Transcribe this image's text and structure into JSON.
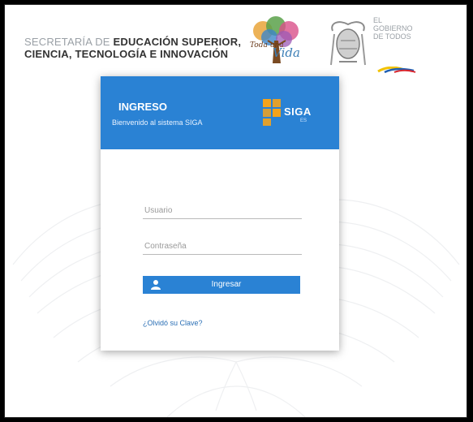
{
  "header": {
    "ministry_line1_light": "SECRETARÍA DE",
    "ministry_line1_bold": "EDUCACIÓN SUPERIOR,",
    "ministry_line2": "CIENCIA, TECNOLOGÍA E INNOVACIÓN",
    "tree_logo_text": "Toda una",
    "tree_logo_vida": "Vida",
    "gov_el": "EL",
    "gov_line": "GOBIERNO",
    "gov_line2": "DE TODOS"
  },
  "login": {
    "title": "INGRESO",
    "subtitle": "Bienvenido al sistema SIGA",
    "brand": "SIGA",
    "brand_sub": "ES",
    "username_placeholder": "Usuario",
    "password_placeholder": "Contraseña",
    "submit_label": "Ingresar",
    "forgot_label": "¿Olvidó su Clave?"
  },
  "colors": {
    "accent": "#2a82d4",
    "brand_orange": "#f4a31c",
    "link": "#2a6fb5"
  },
  "icons": {
    "submit": "user-icon"
  }
}
